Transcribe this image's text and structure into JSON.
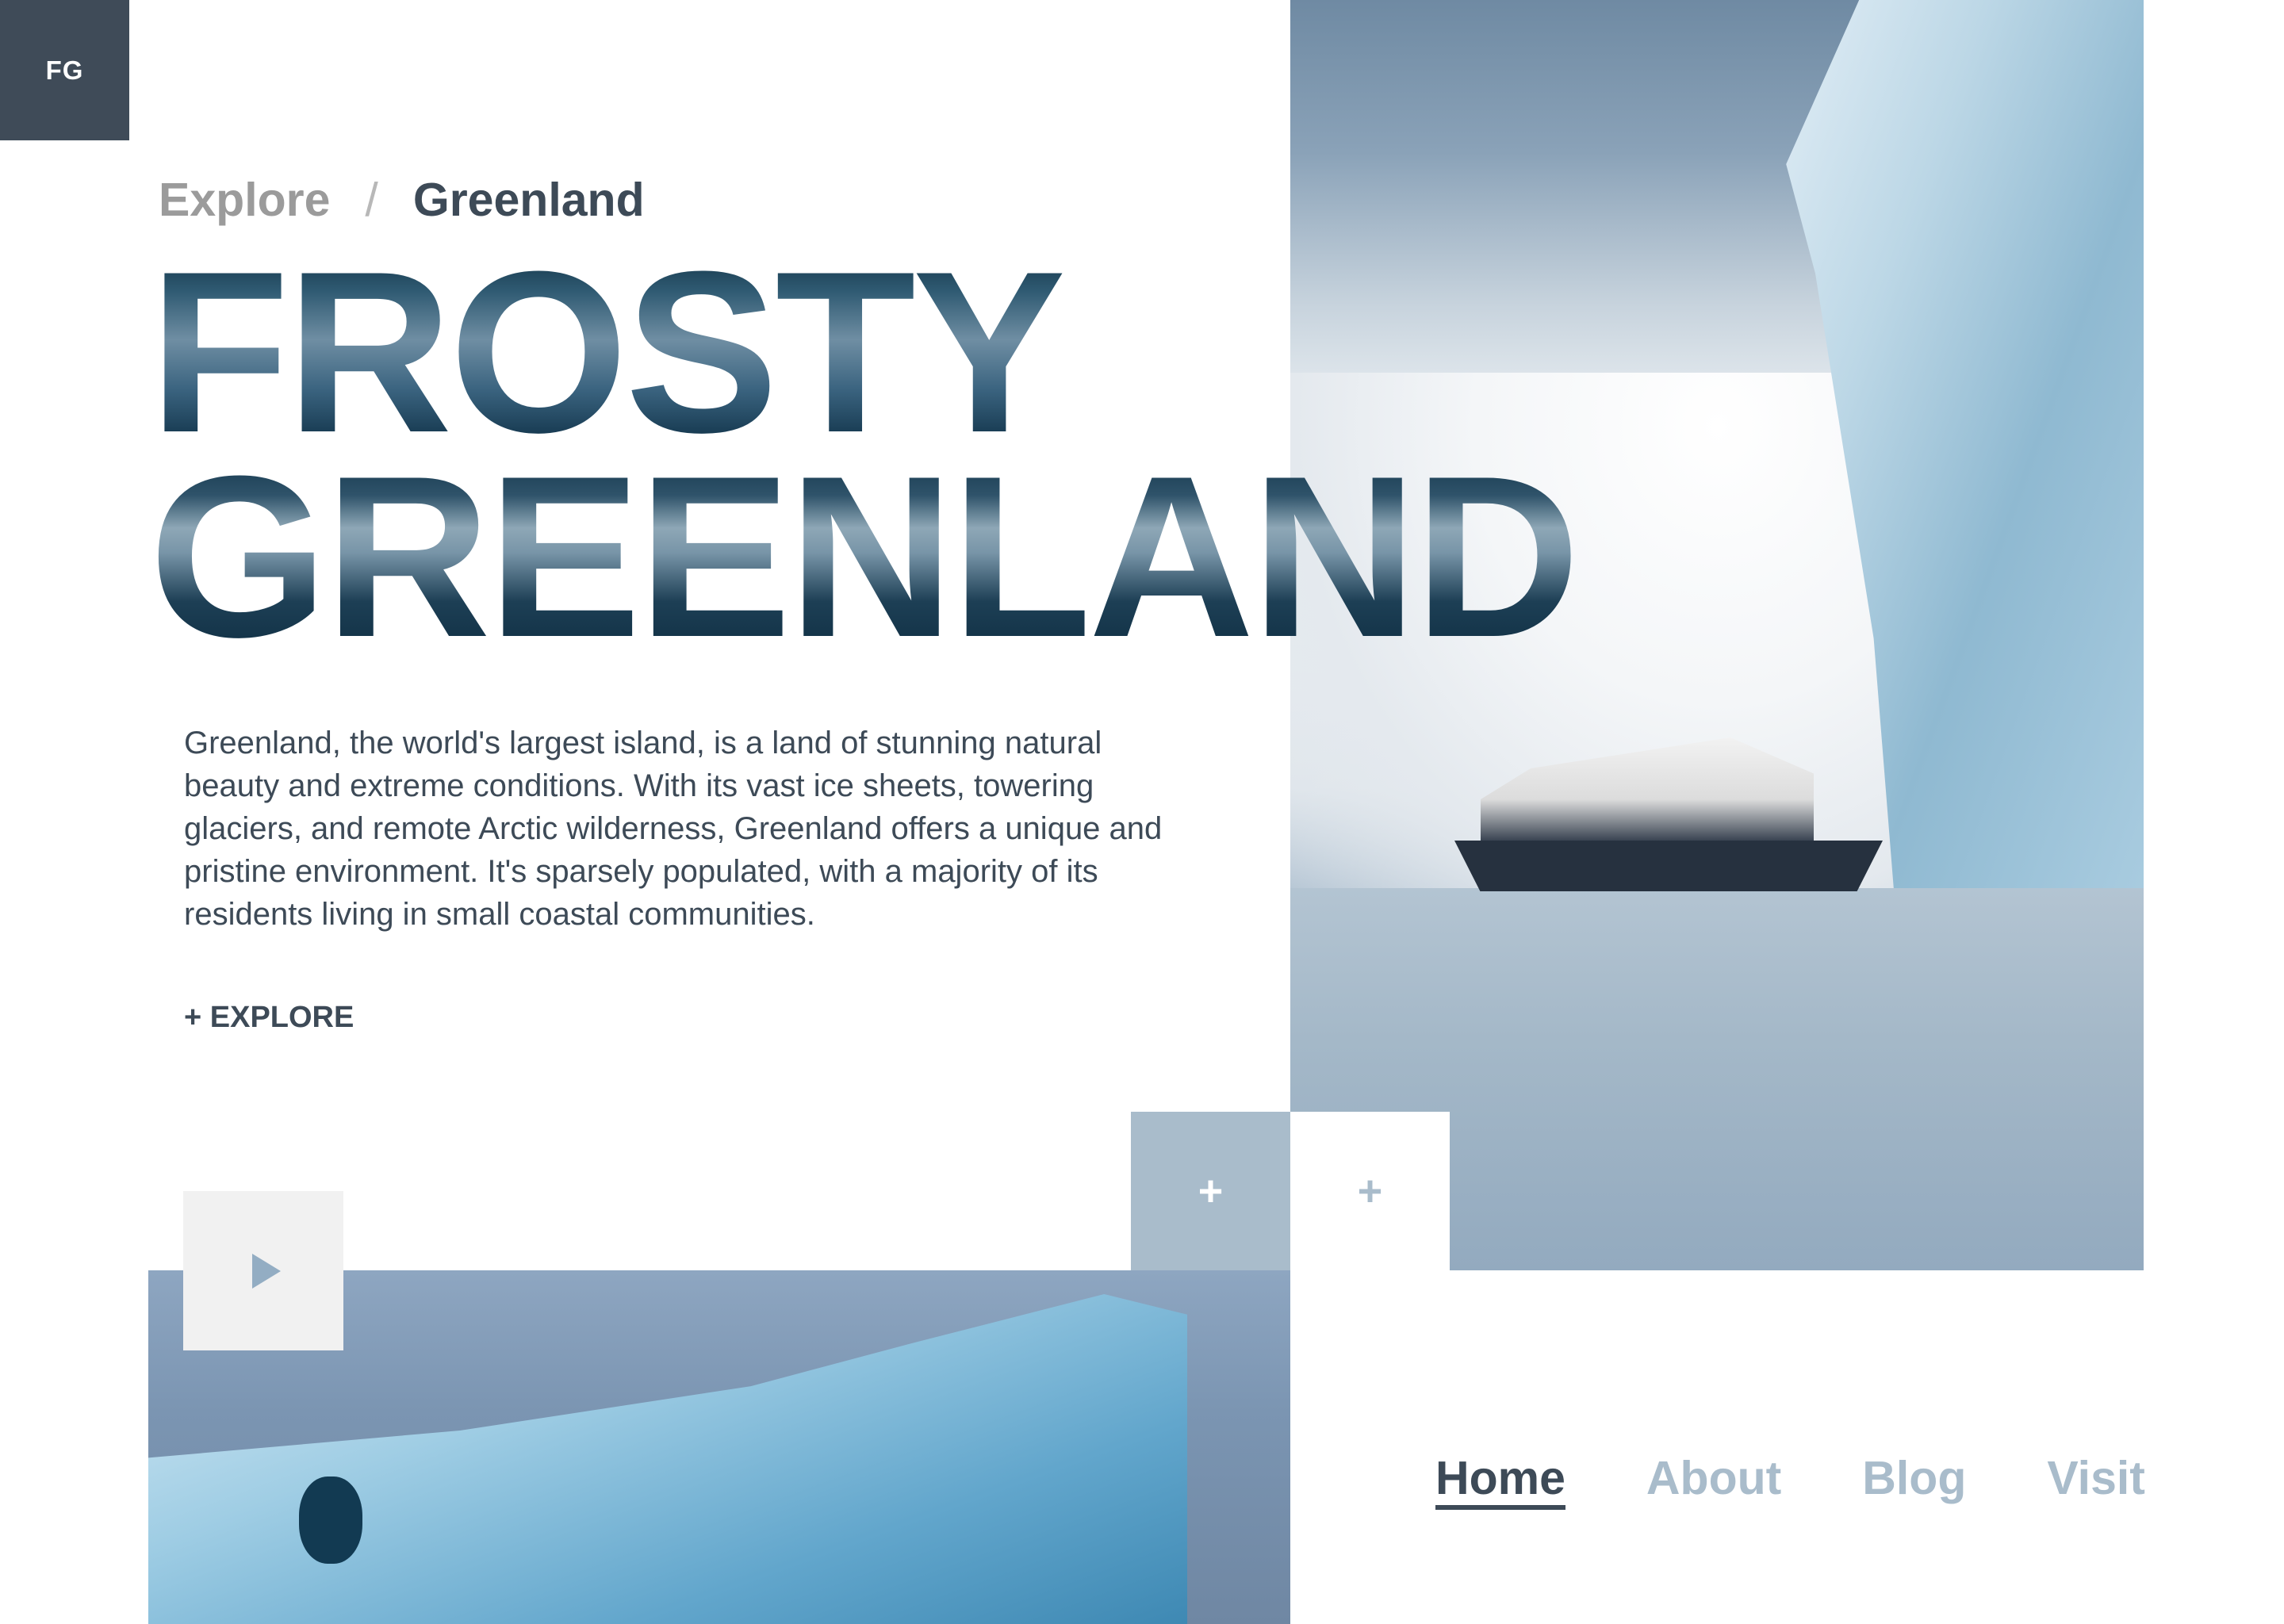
{
  "logo": {
    "text": "FG"
  },
  "breadcrumb": {
    "root": "Explore",
    "separator": "/",
    "current": "Greenland"
  },
  "hero": {
    "line1": "FROSTY",
    "line2": "GREENLAND"
  },
  "description": "Greenland, the world's largest island, is a land of stunning natural beauty and extreme conditions. With its vast ice sheets, towering glaciers, and remote Arctic wilderness, Greenland offers a unique and pristine environment. It's sparsely populated, with a majority of its residents living in small coastal communities.",
  "explore_link": "+ EXPLORE",
  "controls": {
    "plus_1": "+",
    "plus_2": "+",
    "play_icon": "play-icon"
  },
  "nav": {
    "items": [
      {
        "label": "Home",
        "active": true
      },
      {
        "label": "About",
        "active": false
      },
      {
        "label": "Blog",
        "active": false
      },
      {
        "label": "Visit",
        "active": false
      }
    ]
  },
  "colors": {
    "primary": "#3d4a57",
    "accent": "#a9bccb",
    "muted": "#9b9b9b",
    "logo_bg": "#3f4b58"
  }
}
